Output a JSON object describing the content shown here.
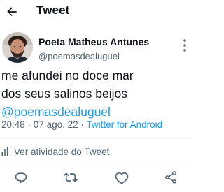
{
  "header": {
    "title": "Tweet"
  },
  "author": {
    "display_name": "Poeta Matheus Antunes",
    "handle": "@poemasdealuguel"
  },
  "tweet": {
    "line1": "me afundei no doce mar",
    "line2": "dos seus salinos beijos",
    "mention": "@poemasdealuguel"
  },
  "meta": {
    "time": "20:48",
    "separator": " · ",
    "date": "07 ago. 22",
    "source": "Twitter for Android"
  },
  "activity": {
    "label": "Ver atividade do Tweet"
  },
  "icons": {
    "back": "arrow-left-icon",
    "more": "more-vertical-icon",
    "activity": "bar-chart-icon",
    "reply": "reply-icon",
    "retweet": "retweet-icon",
    "like": "heart-icon",
    "share": "share-icon"
  },
  "colors": {
    "text": "#0f1419",
    "secondary": "#536471",
    "accent": "#1d9bf0",
    "divider": "#eff3f4"
  }
}
